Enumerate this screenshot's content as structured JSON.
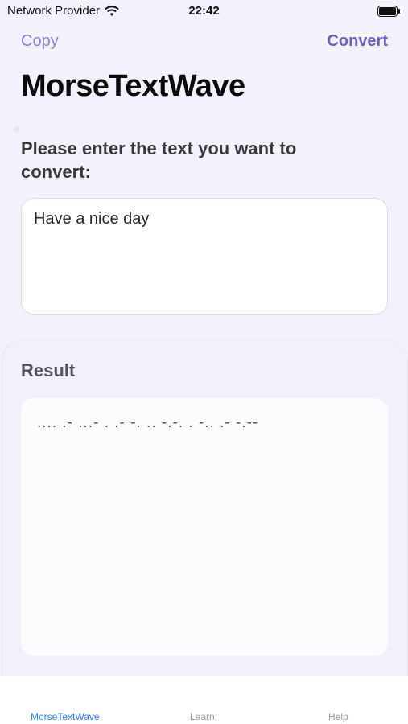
{
  "status_bar": {
    "carrier": "Network Provider",
    "time": "22:42"
  },
  "nav": {
    "copy_label": "Copy",
    "convert_label": "Convert"
  },
  "title": "MorseTextWave",
  "prompt": "Please enter the text you want to convert:",
  "input": {
    "value": "Have a nice day"
  },
  "result": {
    "label": "Result",
    "value": ".... .- ...- . .- -. .. -.-. . -.. .- -.--"
  },
  "tabs": [
    {
      "label": "MorseTextWave",
      "selected": true
    },
    {
      "label": "Learn",
      "selected": false
    },
    {
      "label": "Help",
      "selected": false
    }
  ],
  "colors": {
    "accent": "#6a5fc8",
    "tab_active": "#2f7cf6"
  }
}
